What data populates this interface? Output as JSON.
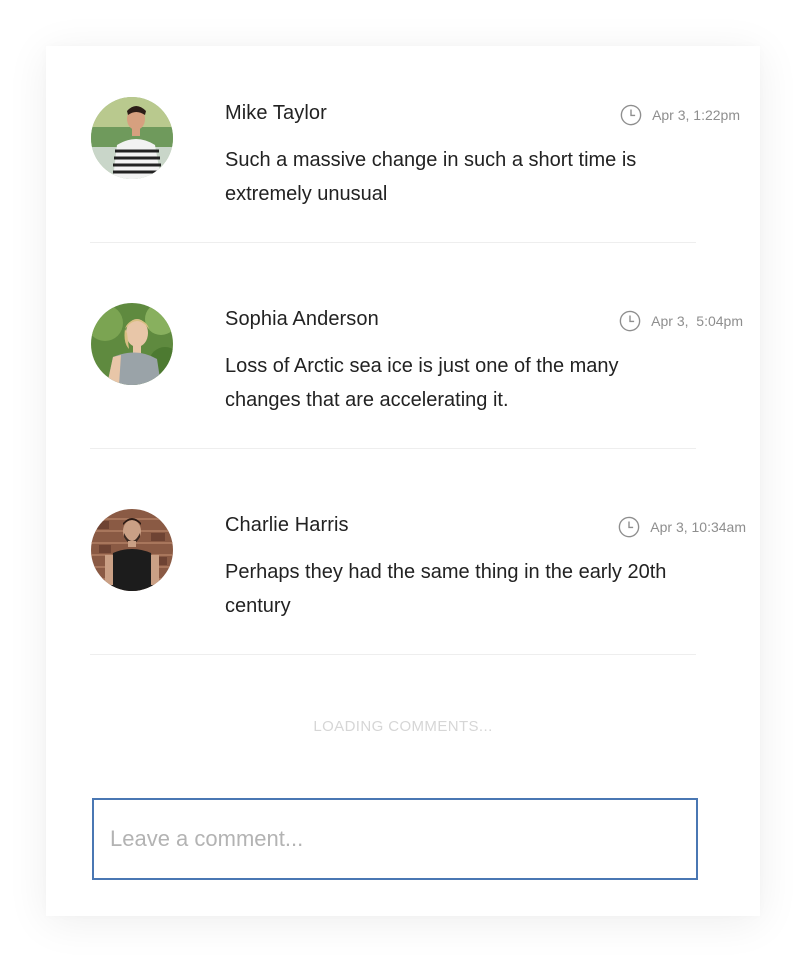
{
  "comments": [
    {
      "author": "Mike Taylor",
      "time": "Apr 3, 1:22pm",
      "text": "Such a massive change in such a short time is extremely unusual",
      "avatar_icon": "user-avatar-mike"
    },
    {
      "author": "Sophia Anderson",
      "time": "Apr 3,  5:04pm",
      "text": "Loss of Arctic sea ice is just one of the many changes that are accelerating it.",
      "avatar_icon": "user-avatar-sophia"
    },
    {
      "author": "Charlie Harris",
      "time": "Apr 3, 10:34am",
      "text": "Perhaps they had the same thing in the early 20th century",
      "avatar_icon": "user-avatar-charlie"
    }
  ],
  "loading_text": "LOADING COMMENTS...",
  "comment_input": {
    "placeholder": "Leave a comment...",
    "value": ""
  },
  "colors": {
    "input_border": "#4a77b3",
    "muted_text": "#8e8e8e",
    "loading_text": "#d6d6d6"
  }
}
